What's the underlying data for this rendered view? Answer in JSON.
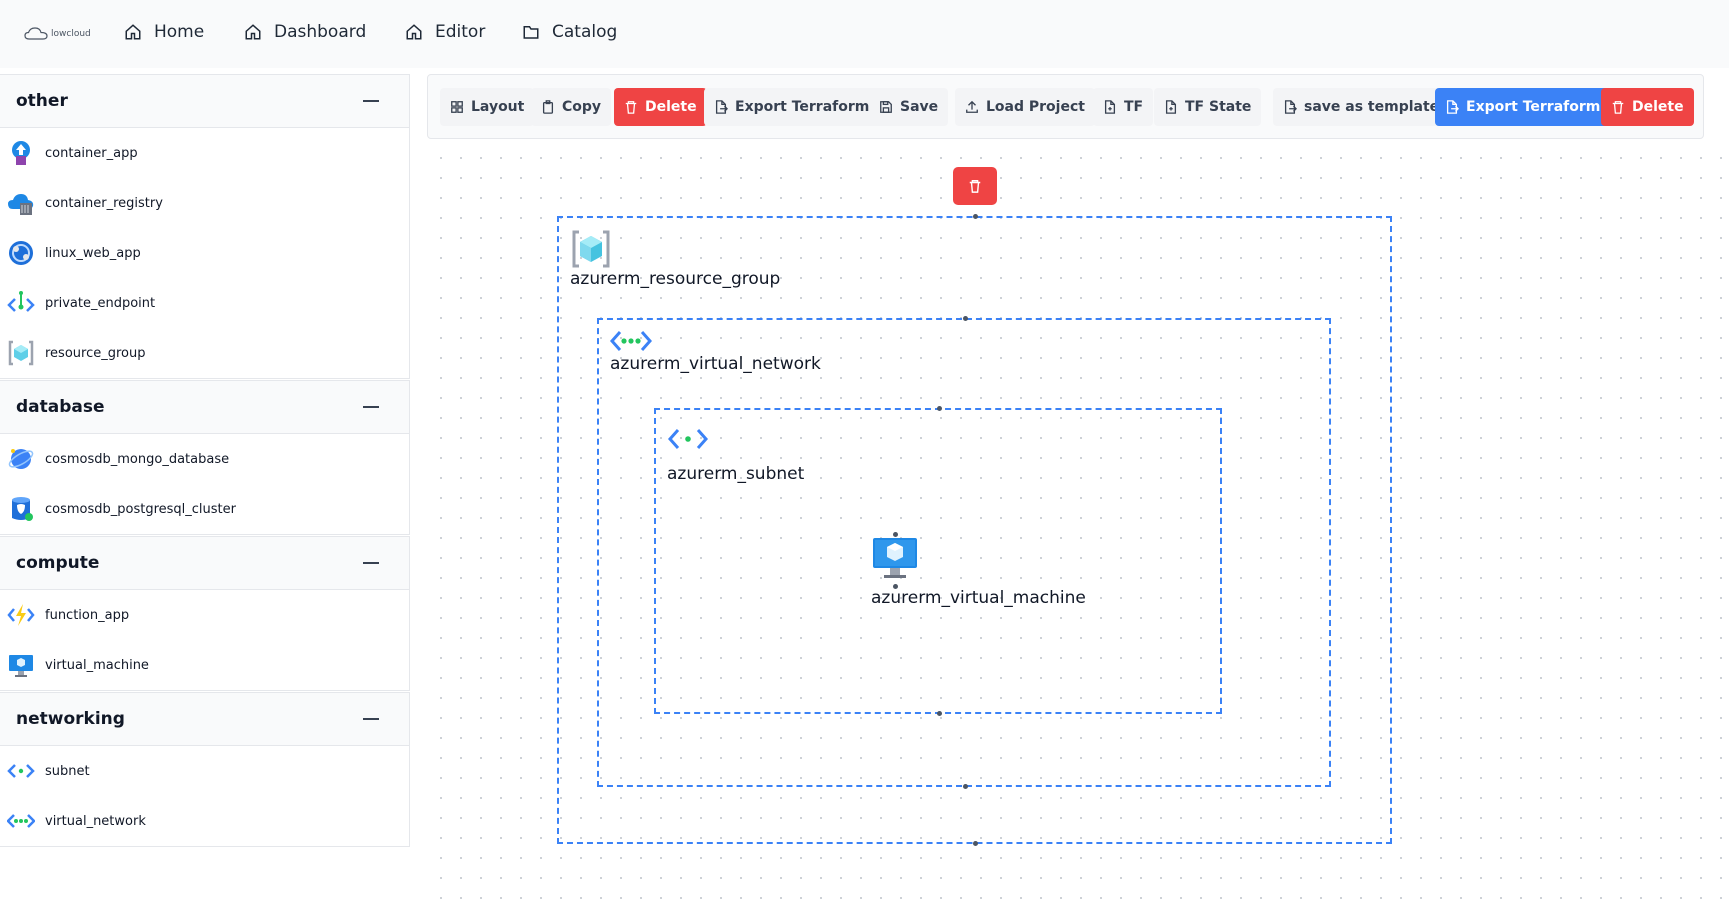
{
  "brand": {
    "logo_text": "lowcloud"
  },
  "nav": [
    {
      "label": "Home",
      "icon": "home-icon"
    },
    {
      "label": "Dashboard",
      "icon": "home-icon"
    },
    {
      "label": "Editor",
      "icon": "home-icon"
    },
    {
      "label": "Catalog",
      "icon": "folder-icon"
    }
  ],
  "sidebar": {
    "groups": [
      {
        "title": "other",
        "items": [
          {
            "label": "container_app",
            "icon": "container-app-icon"
          },
          {
            "label": "container_registry",
            "icon": "container-registry-icon"
          },
          {
            "label": "linux_web_app",
            "icon": "web-app-icon"
          },
          {
            "label": "private_endpoint",
            "icon": "private-endpoint-icon"
          },
          {
            "label": "resource_group",
            "icon": "resource-group-icon"
          }
        ]
      },
      {
        "title": "database",
        "items": [
          {
            "label": "cosmosdb_mongo_database",
            "icon": "cosmosdb-icon"
          },
          {
            "label": "cosmosdb_postgresql_cluster",
            "icon": "postgresql-icon"
          }
        ]
      },
      {
        "title": "compute",
        "items": [
          {
            "label": "function_app",
            "icon": "function-app-icon"
          },
          {
            "label": "virtual_machine",
            "icon": "virtual-machine-icon"
          }
        ]
      },
      {
        "title": "networking",
        "items": [
          {
            "label": "subnet",
            "icon": "subnet-icon"
          },
          {
            "label": "virtual_network",
            "icon": "virtual-network-icon"
          }
        ]
      }
    ]
  },
  "toolbar": {
    "layout": "Layout",
    "copy": "Copy",
    "delete": "Delete",
    "export_terraform": "Export Terraform",
    "save": "Save",
    "load_project": "Load Project",
    "tf": "TF",
    "tf_state": "TF State",
    "save_as_template": "save as template",
    "export_terraform_primary": "Export Terraform",
    "delete_2": "Delete"
  },
  "canvas": {
    "nodes": {
      "resource_group": "azurerm_resource_group",
      "virtual_network": "azurerm_virtual_network",
      "subnet": "azurerm_subnet",
      "virtual_machine": "azurerm_virtual_machine"
    }
  },
  "colors": {
    "accent": "#3b82f6",
    "danger": "#ef4444",
    "text": "#111827"
  }
}
